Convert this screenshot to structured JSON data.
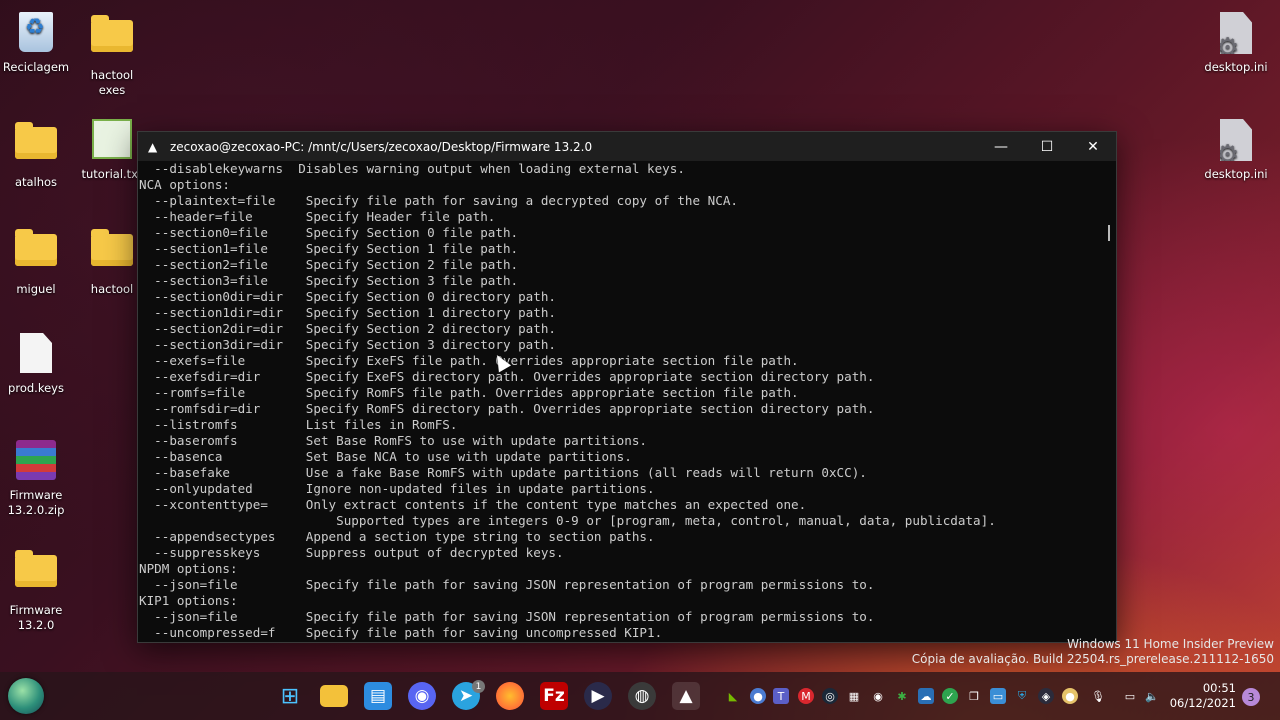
{
  "desktop": {
    "icons": [
      {
        "label": "Reciclagem",
        "icon": "recycle-bin-icon"
      },
      {
        "label": "hactool exes",
        "icon": "folder-icon"
      },
      {
        "label": "atalhos",
        "icon": "folder-icon"
      },
      {
        "label": "tutorial.txt",
        "icon": "notepad-file-icon"
      },
      {
        "label": "miguel",
        "icon": "folder-icon"
      },
      {
        "label": "hactool",
        "icon": "folder-icon"
      },
      {
        "label": "prod.keys",
        "icon": "file-icon"
      },
      {
        "label": "Firmware 13.2.0.zip",
        "icon": "winrar-archive-icon"
      },
      {
        "label": "Firmware 13.2.0",
        "icon": "folder-icon"
      },
      {
        "label": "desktop.ini",
        "icon": "settings-file-icon"
      },
      {
        "label": "desktop.ini",
        "icon": "settings-file-icon"
      }
    ]
  },
  "terminal": {
    "title": "zecoxao@zecoxao-PC: /mnt/c/Users/zecoxao/Desktop/Firmware 13.2.0",
    "lines": [
      "  --disablekeywarns  Disables warning output when loading external keys.",
      "NCA options:",
      "  --plaintext=file    Specify file path for saving a decrypted copy of the NCA.",
      "  --header=file       Specify Header file path.",
      "  --section0=file     Specify Section 0 file path.",
      "  --section1=file     Specify Section 1 file path.",
      "  --section2=file     Specify Section 2 file path.",
      "  --section3=file     Specify Section 3 file path.",
      "  --section0dir=dir   Specify Section 0 directory path.",
      "  --section1dir=dir   Specify Section 1 directory path.",
      "  --section2dir=dir   Specify Section 2 directory path.",
      "  --section3dir=dir   Specify Section 3 directory path.",
      "  --exefs=file        Specify ExeFS file path. Overrides appropriate section file path.",
      "  --exefsdir=dir      Specify ExeFS directory path. Overrides appropriate section directory path.",
      "  --romfs=file        Specify RomFS file path. Overrides appropriate section file path.",
      "  --romfsdir=dir      Specify RomFS directory path. Overrides appropriate section directory path.",
      "  --listromfs         List files in RomFS.",
      "  --baseromfs         Set Base RomFS to use with update partitions.",
      "  --basenca           Set Base NCA to use with update partitions.",
      "  --basefake          Use a fake Base RomFS with update partitions (all reads will return 0xCC).",
      "  --onlyupdated       Ignore non-updated files in update partitions.",
      "  --xcontenttype=     Only extract contents if the content type matches an expected one.",
      "                          Supported types are integers 0-9 or [program, meta, control, manual, data, publicdata].",
      "  --appendsectypes    Append a section type string to section paths.",
      "  --suppresskeys      Suppress output of decrypted keys.",
      "NPDM options:",
      "  --json=file         Specify file path for saving JSON representation of program permissions to.",
      "KIP1 options:",
      "  --json=file         Specify file path for saving JSON representation of program permissions to.",
      "  --uncompressed=f    Specify file path for saving uncompressed KIP1."
    ]
  },
  "watermark": {
    "line1": "Windows 11 Home Insider Preview",
    "line2": "Cópia de avaliação. Build 22504.rs_prerelease.211112-1650"
  },
  "taskbar": {
    "pinned": [
      "windows-start-icon",
      "file-explorer-icon",
      "microsoft-store-icon",
      "discord-icon",
      "telegram-icon",
      "firefox-icon",
      "filezilla-icon",
      "media-player-icon",
      "obs-icon",
      "linux-terminal-icon"
    ],
    "telegram_badge": "1",
    "tray": [
      "nvidia-icon",
      "network-globe-icon",
      "teams-icon",
      "mega-icon",
      "steam-icon",
      "notepad-icon",
      "discord-tray-icon",
      "xbox-icon",
      "onedrive-icon",
      "check-icon",
      "copy-icon",
      "window-icon",
      "remote-icon",
      "shield-icon",
      "audio-icon",
      "media-icon",
      "microphone-icon",
      "display-icon",
      "volume-icon"
    ],
    "time": "00:51",
    "date": "06/12/2021",
    "notification_count": "3"
  }
}
